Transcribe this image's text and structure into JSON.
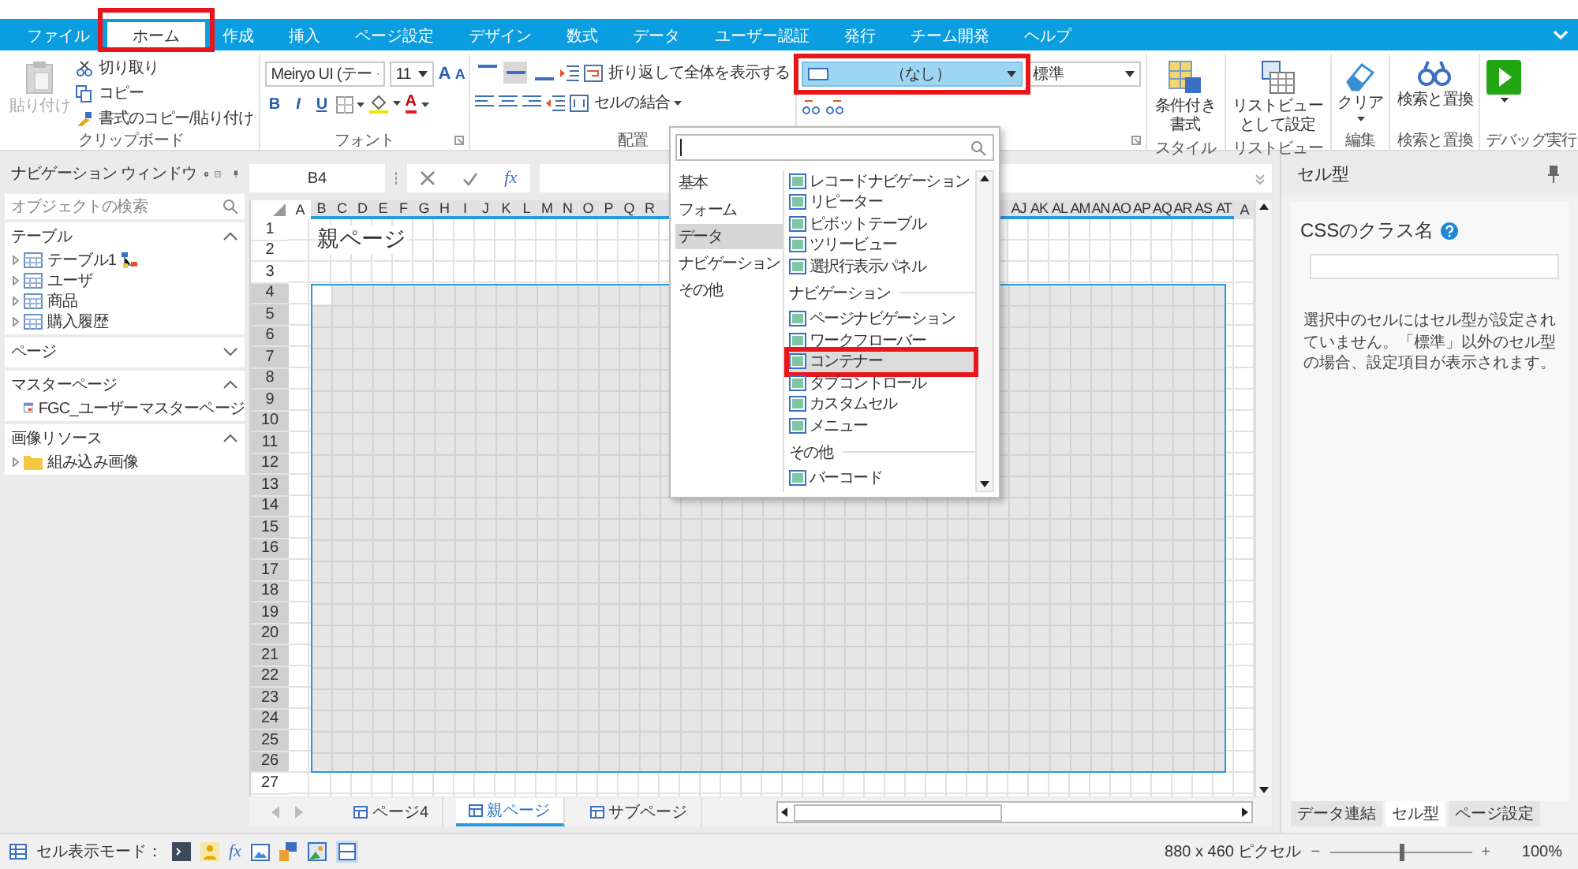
{
  "ribbon_tabs": [
    {
      "label": "ファイル",
      "selected": false,
      "highlighted": false
    },
    {
      "label": "ホーム",
      "selected": true,
      "highlighted": true
    },
    {
      "label": "作成",
      "selected": false,
      "highlighted": false
    },
    {
      "label": "挿入",
      "selected": false,
      "highlighted": false
    },
    {
      "label": "ページ設定",
      "selected": false,
      "highlighted": false
    },
    {
      "label": "デザイン",
      "selected": false,
      "highlighted": false
    },
    {
      "label": "数式",
      "selected": false,
      "highlighted": false
    },
    {
      "label": "データ",
      "selected": false,
      "highlighted": false
    },
    {
      "label": "ユーザー認証",
      "selected": false,
      "highlighted": false
    },
    {
      "label": "発行",
      "selected": false,
      "highlighted": false
    },
    {
      "label": "チーム開発",
      "selected": false,
      "highlighted": false
    },
    {
      "label": "ヘルプ",
      "selected": false,
      "highlighted": false
    }
  ],
  "ribbon": {
    "clipboard": {
      "paste": "貼り付け",
      "paste_disabled": true,
      "cut": "切り取り",
      "copy": "コピー",
      "format_painter": "書式のコピー/貼り付け",
      "group": "クリップボード"
    },
    "font": {
      "family": "Meiryo UI (テー",
      "size": "11",
      "grow": "A",
      "shrink": "A",
      "bold": "B",
      "italic": "I",
      "underline": "U",
      "font_color": "A",
      "group": "フォント"
    },
    "alignment": {
      "vertical_align_buttons": [
        {
          "selected": false
        },
        {
          "selected": true
        },
        {
          "selected": false
        }
      ],
      "wrap": "折り返して全体を表示する",
      "merge": "セルの結合",
      "group": "配置"
    },
    "cell_type": {
      "value": "（なし）",
      "highlighted": true,
      "style_value": "標準"
    },
    "style": {
      "button": "条件付き書式",
      "group": "スタイル"
    },
    "list_view": {
      "button": "リストビューとして設定",
      "group": "リストビュー"
    },
    "edit": {
      "button": "クリア",
      "group": "編集"
    },
    "find": {
      "button": "検索と置換",
      "group": "検索と置換"
    },
    "debug": {
      "group": "デバッグ実行"
    }
  },
  "navigation": {
    "title": "ナビゲーション ウィンドウ",
    "search_placeholder": "オブジェクトの検索",
    "sections": [
      {
        "title": "テーブル",
        "expanded": true,
        "items": [
          {
            "label": "テーブル1",
            "kind": "table",
            "related": true
          },
          {
            "label": "ユーザ",
            "kind": "table",
            "related": false
          },
          {
            "label": "商品",
            "kind": "table",
            "related": false
          },
          {
            "label": "購入履歴",
            "kind": "table",
            "related": false
          }
        ]
      },
      {
        "title": "ページ",
        "expanded": false
      },
      {
        "title": "マスターページ",
        "expanded": true,
        "items": [
          {
            "label": "FGC_ユーザーマスターページ",
            "kind": "master_page",
            "related": false
          }
        ]
      },
      {
        "title": "画像リソース",
        "expanded": true,
        "items": [
          {
            "label": "組み込み画像",
            "kind": "folder",
            "related": false
          }
        ]
      }
    ]
  },
  "formula_bar": {
    "cell_ref": "B4",
    "fx": "fx"
  },
  "sheet": {
    "columns_left": [
      "A",
      "B",
      "C",
      "D",
      "E",
      "F",
      "G",
      "H",
      "I",
      "J",
      "K",
      "L",
      "M",
      "N",
      "O",
      "P",
      "Q",
      "R"
    ],
    "columns_right": [
      "AJ",
      "AK",
      "AL",
      "AM",
      "AN",
      "AO",
      "AP",
      "AQ",
      "AR",
      "AS",
      "AT",
      "A"
    ],
    "title_cell": "親ページ",
    "rows": [
      {
        "label": "1",
        "selected": false
      },
      {
        "label": "2",
        "selected": false
      },
      {
        "label": "3",
        "selected": false
      },
      {
        "label": "4",
        "selected": true
      },
      {
        "label": "5",
        "selected": true
      },
      {
        "label": "6",
        "selected": true
      },
      {
        "label": "7",
        "selected": true
      },
      {
        "label": "8",
        "selected": true
      },
      {
        "label": "9",
        "selected": true
      },
      {
        "label": "10",
        "selected": true
      },
      {
        "label": "11",
        "selected": true
      },
      {
        "label": "12",
        "selected": true
      },
      {
        "label": "13",
        "selected": true
      },
      {
        "label": "14",
        "selected": true
      },
      {
        "label": "15",
        "selected": true
      },
      {
        "label": "16",
        "selected": true
      },
      {
        "label": "17",
        "selected": true
      },
      {
        "label": "18",
        "selected": true
      },
      {
        "label": "19",
        "selected": true
      },
      {
        "label": "20",
        "selected": true
      },
      {
        "label": "21",
        "selected": true
      },
      {
        "label": "22",
        "selected": true
      },
      {
        "label": "23",
        "selected": true
      },
      {
        "label": "24",
        "selected": true
      },
      {
        "label": "25",
        "selected": true
      },
      {
        "label": "26",
        "selected": true
      },
      {
        "label": "27",
        "selected": false
      }
    ],
    "tabs": [
      {
        "label": "ページ4",
        "selected": false
      },
      {
        "label": "親ページ",
        "selected": true
      },
      {
        "label": "サブページ",
        "selected": false
      }
    ]
  },
  "cell_type_menu": {
    "categories": [
      {
        "label": "基本",
        "selected": false
      },
      {
        "label": "フォーム",
        "selected": false
      },
      {
        "label": "データ",
        "selected": true
      },
      {
        "label": "ナビゲーション",
        "selected": false
      },
      {
        "label": "その他",
        "selected": false
      }
    ],
    "groups": [
      {
        "items": [
          {
            "label": "レコードナビゲーション",
            "selected": false,
            "highlighted": false
          },
          {
            "label": "リピーター",
            "selected": false,
            "highlighted": false
          },
          {
            "label": "ピボットテーブル",
            "selected": false,
            "highlighted": false
          },
          {
            "label": "ツリービュー",
            "selected": false,
            "highlighted": false
          },
          {
            "label": "選択行表示パネル",
            "selected": false,
            "highlighted": false
          }
        ]
      },
      {
        "title": "ナビゲーション",
        "items": [
          {
            "label": "ページナビゲーション",
            "selected": false,
            "highlighted": false
          },
          {
            "label": "ワークフローバー",
            "selected": false,
            "highlighted": false
          },
          {
            "label": "コンテナー",
            "selected": true,
            "highlighted": true
          },
          {
            "label": "タブコントロール",
            "selected": false,
            "highlighted": false
          },
          {
            "label": "カスタムセル",
            "selected": false,
            "highlighted": false
          },
          {
            "label": "メニュー",
            "selected": false,
            "highlighted": false
          }
        ]
      },
      {
        "title": "その他",
        "items": [
          {
            "label": "バーコード",
            "selected": false,
            "highlighted": false
          }
        ]
      }
    ]
  },
  "properties": {
    "title": "セル型",
    "css_label": "CSSのクラス名",
    "message": "選択中のセルにはセル型が設定されていません。「標準」以外のセル型の場合、設定項目が表示されます。",
    "tabs": [
      {
        "label": "データ連結",
        "selected": false
      },
      {
        "label": "セル型",
        "selected": true
      },
      {
        "label": "ページ設定",
        "selected": false
      }
    ]
  },
  "status_bar": {
    "mode_label": "セル表示モード：",
    "mode_fx": "fx",
    "size": "880 x 460 ピクセル",
    "zoom": {
      "minus": "−",
      "plus": "+",
      "level": 0.5,
      "reading": "100%"
    }
  }
}
